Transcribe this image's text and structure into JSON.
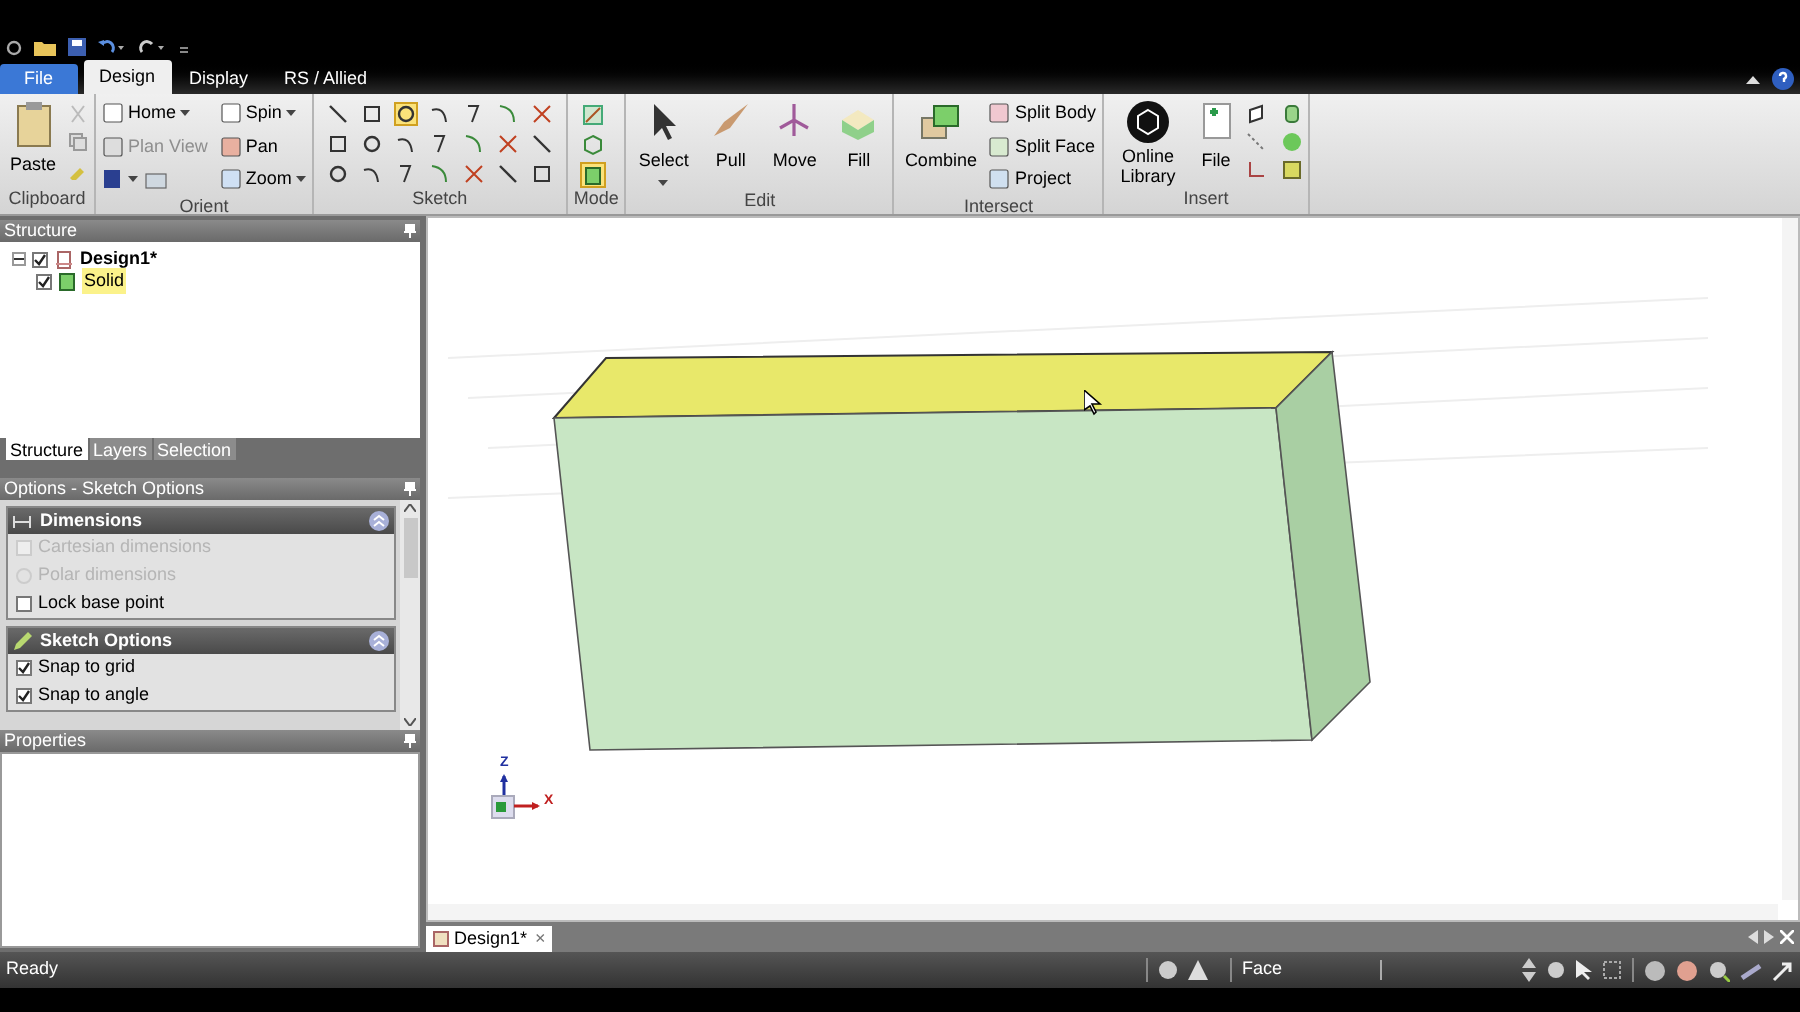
{
  "ribbon_tabs": [
    {
      "label": "File",
      "kind": "file",
      "selected": false
    },
    {
      "label": "Design",
      "kind": "tab",
      "selected": true
    },
    {
      "label": "Display",
      "kind": "tab",
      "selected": false
    },
    {
      "label": "RS / Allied",
      "kind": "tab",
      "selected": false
    }
  ],
  "ribbon": {
    "groups": [
      {
        "label": "Clipboard",
        "kind": "clipboard",
        "buttons": [
          {
            "label": "Paste"
          }
        ]
      },
      {
        "label": "Orient",
        "kind": "orient",
        "buttons": [
          {
            "label": "Home",
            "disabled": false
          },
          {
            "label": "Spin",
            "disabled": false
          },
          {
            "label": "Plan View",
            "disabled": true
          },
          {
            "label": "Pan",
            "disabled": false
          },
          {
            "label": "Zoom",
            "disabled": false
          }
        ]
      },
      {
        "label": "Sketch",
        "kind": "sketch"
      },
      {
        "label": "Mode",
        "kind": "mode"
      },
      {
        "label": "Edit",
        "kind": "large",
        "buttons": [
          {
            "label": "Select"
          },
          {
            "label": "Pull"
          },
          {
            "label": "Move"
          },
          {
            "label": "Fill"
          }
        ]
      },
      {
        "label": "Intersect",
        "kind": "intersect",
        "buttons": [
          {
            "label": "Combine"
          },
          {
            "label": "Split Body"
          },
          {
            "label": "Split Face"
          },
          {
            "label": "Project"
          }
        ]
      },
      {
        "label": "Insert",
        "kind": "insert",
        "buttons": [
          {
            "label": "Online Library"
          },
          {
            "label": "File"
          }
        ]
      }
    ]
  },
  "structure": {
    "title": "Structure",
    "tree": [
      {
        "label": "Design1*",
        "checked": true,
        "expanded": true,
        "children": [
          {
            "label": "Solid",
            "checked": true,
            "selected": true
          }
        ]
      }
    ],
    "tabs": [
      {
        "label": "Structure",
        "selected": true
      },
      {
        "label": "Layers",
        "selected": false
      },
      {
        "label": "Selection",
        "selected": false
      }
    ]
  },
  "options": {
    "title": "Options - Sketch Options",
    "sections": [
      {
        "title": "Dimensions",
        "items": [
          {
            "kind": "checkbox",
            "label": "Cartesian dimensions",
            "checked": false,
            "disabled": true
          },
          {
            "kind": "radio",
            "label": "Polar dimensions",
            "checked": false,
            "disabled": true
          },
          {
            "kind": "checkbox",
            "label": "Lock base point",
            "checked": false,
            "disabled": false
          }
        ]
      },
      {
        "title": "Sketch Options",
        "items": [
          {
            "kind": "checkbox",
            "label": "Snap to grid",
            "checked": true,
            "disabled": false
          },
          {
            "kind": "checkbox",
            "label": "Snap to angle",
            "checked": true,
            "disabled": false
          }
        ]
      }
    ]
  },
  "properties": {
    "title": "Properties"
  },
  "viewport": {
    "axes": [
      {
        "label": "Z"
      },
      {
        "label": "X"
      }
    ]
  },
  "document_tabs": [
    {
      "label": "Design1*",
      "close": "×",
      "selected": true
    }
  ],
  "status_bar": {
    "message": "Ready",
    "selection_filter": "Face"
  }
}
